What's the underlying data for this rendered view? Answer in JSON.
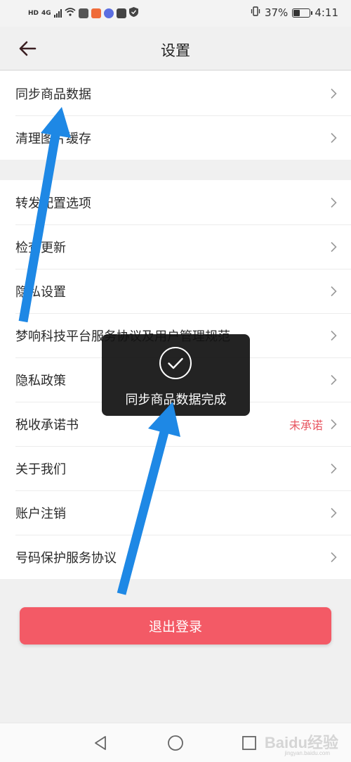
{
  "status_bar": {
    "network_label": "HD",
    "network_gen": "4G",
    "battery_percent": "37%",
    "time": "4:11",
    "battery_level": 0.37
  },
  "nav": {
    "title": "设置",
    "back_icon": "arrow-left-icon"
  },
  "settings": {
    "group1": [
      {
        "label": "同步商品数据"
      },
      {
        "label": "清理图片缓存"
      }
    ],
    "group2": [
      {
        "label": "转发配置选项"
      },
      {
        "label": "检查更新"
      },
      {
        "label": "隐私设置"
      },
      {
        "label": "梦响科技平台服务协议及用户管理规范"
      },
      {
        "label": "隐私政策"
      },
      {
        "label": "税收承诺书",
        "value": "未承诺"
      },
      {
        "label": "关于我们"
      },
      {
        "label": "账户注销"
      },
      {
        "label": "号码保护服务协议"
      }
    ]
  },
  "logout_label": "退出登录",
  "toast": {
    "message": "同步商品数据完成",
    "icon": "check-circle-icon"
  },
  "watermark": {
    "text": "Baidu经验",
    "sub": "jingyan.baidu.com"
  },
  "colors": {
    "accent": "#f35a66",
    "annotation_arrow": "#1e88e5",
    "warning_text": "#e85560"
  }
}
